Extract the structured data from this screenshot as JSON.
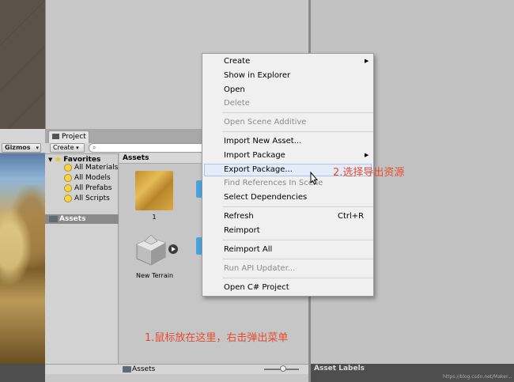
{
  "project_window": {
    "tab_label": "Project",
    "create_label": "Create",
    "search_placeholder": "",
    "gizmos_label": "Gizmos",
    "favorites": {
      "title": "Favorites",
      "items": [
        "All Materials",
        "All Models",
        "All Prefabs",
        "All Scripts"
      ]
    },
    "tree_assets_label": "Assets",
    "assets_header": "Assets",
    "grid_items": [
      {
        "label": "1",
        "icon": "gold-material-icon"
      },
      {
        "label": "New Terrain",
        "icon": "terrain-icon"
      }
    ],
    "footer_path": "Assets"
  },
  "right_panel": {
    "asset_labels": "Asset Labels",
    "watermark": "https://blog.csdn.net/Maker..."
  },
  "context_menu": {
    "items": [
      {
        "label": "Create",
        "submenu": true,
        "disabled": false
      },
      {
        "label": "Show in Explorer",
        "disabled": false
      },
      {
        "label": "Open",
        "disabled": false
      },
      {
        "label": "Delete",
        "disabled": true
      },
      {
        "label": "Open Scene Additive",
        "disabled": true
      },
      {
        "label": "Import New Asset...",
        "disabled": false
      },
      {
        "label": "Import Package",
        "submenu": true,
        "disabled": false
      },
      {
        "label": "Export Package...",
        "disabled": false,
        "highlighted": true
      },
      {
        "label": "Find References In Scene",
        "disabled": true
      },
      {
        "label": "Select Dependencies",
        "disabled": false
      },
      {
        "label": "Refresh",
        "shortcut": "Ctrl+R",
        "disabled": false
      },
      {
        "label": "Reimport",
        "disabled": false
      },
      {
        "label": "Reimport All",
        "disabled": false
      },
      {
        "label": "Run API Updater...",
        "disabled": true
      },
      {
        "label": "Open C# Project",
        "disabled": false
      }
    ]
  },
  "annotations": {
    "step1": "1.鼠标放在这里，右击弹出菜单",
    "step2": "2.选择导出资源"
  },
  "colors": {
    "annotation": "#e74a2f",
    "menu_highlight": "#e3ecf8",
    "disabled_text": "#8a8a8a"
  }
}
